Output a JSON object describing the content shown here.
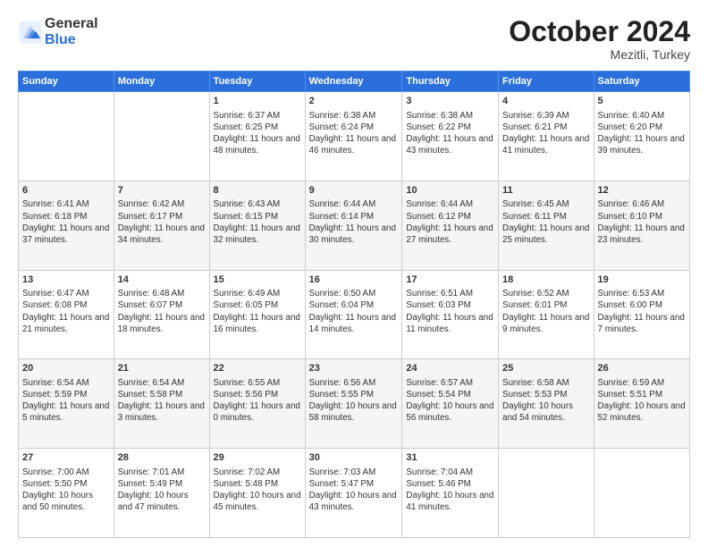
{
  "header": {
    "logo_general": "General",
    "logo_blue": "Blue",
    "month": "October 2024",
    "location": "Mezitli, Turkey"
  },
  "days_of_week": [
    "Sunday",
    "Monday",
    "Tuesday",
    "Wednesday",
    "Thursday",
    "Friday",
    "Saturday"
  ],
  "weeks": [
    [
      {
        "day": "",
        "info": ""
      },
      {
        "day": "",
        "info": ""
      },
      {
        "day": "1",
        "info": "Sunrise: 6:37 AM\nSunset: 6:25 PM\nDaylight: 11 hours and 48 minutes."
      },
      {
        "day": "2",
        "info": "Sunrise: 6:38 AM\nSunset: 6:24 PM\nDaylight: 11 hours and 46 minutes."
      },
      {
        "day": "3",
        "info": "Sunrise: 6:38 AM\nSunset: 6:22 PM\nDaylight: 11 hours and 43 minutes."
      },
      {
        "day": "4",
        "info": "Sunrise: 6:39 AM\nSunset: 6:21 PM\nDaylight: 11 hours and 41 minutes."
      },
      {
        "day": "5",
        "info": "Sunrise: 6:40 AM\nSunset: 6:20 PM\nDaylight: 11 hours and 39 minutes."
      }
    ],
    [
      {
        "day": "6",
        "info": "Sunrise: 6:41 AM\nSunset: 6:18 PM\nDaylight: 11 hours and 37 minutes."
      },
      {
        "day": "7",
        "info": "Sunrise: 6:42 AM\nSunset: 6:17 PM\nDaylight: 11 hours and 34 minutes."
      },
      {
        "day": "8",
        "info": "Sunrise: 6:43 AM\nSunset: 6:15 PM\nDaylight: 11 hours and 32 minutes."
      },
      {
        "day": "9",
        "info": "Sunrise: 6:44 AM\nSunset: 6:14 PM\nDaylight: 11 hours and 30 minutes."
      },
      {
        "day": "10",
        "info": "Sunrise: 6:44 AM\nSunset: 6:12 PM\nDaylight: 11 hours and 27 minutes."
      },
      {
        "day": "11",
        "info": "Sunrise: 6:45 AM\nSunset: 6:11 PM\nDaylight: 11 hours and 25 minutes."
      },
      {
        "day": "12",
        "info": "Sunrise: 6:46 AM\nSunset: 6:10 PM\nDaylight: 11 hours and 23 minutes."
      }
    ],
    [
      {
        "day": "13",
        "info": "Sunrise: 6:47 AM\nSunset: 6:08 PM\nDaylight: 11 hours and 21 minutes."
      },
      {
        "day": "14",
        "info": "Sunrise: 6:48 AM\nSunset: 6:07 PM\nDaylight: 11 hours and 18 minutes."
      },
      {
        "day": "15",
        "info": "Sunrise: 6:49 AM\nSunset: 6:05 PM\nDaylight: 11 hours and 16 minutes."
      },
      {
        "day": "16",
        "info": "Sunrise: 6:50 AM\nSunset: 6:04 PM\nDaylight: 11 hours and 14 minutes."
      },
      {
        "day": "17",
        "info": "Sunrise: 6:51 AM\nSunset: 6:03 PM\nDaylight: 11 hours and 11 minutes."
      },
      {
        "day": "18",
        "info": "Sunrise: 6:52 AM\nSunset: 6:01 PM\nDaylight: 11 hours and 9 minutes."
      },
      {
        "day": "19",
        "info": "Sunrise: 6:53 AM\nSunset: 6:00 PM\nDaylight: 11 hours and 7 minutes."
      }
    ],
    [
      {
        "day": "20",
        "info": "Sunrise: 6:54 AM\nSunset: 5:59 PM\nDaylight: 11 hours and 5 minutes."
      },
      {
        "day": "21",
        "info": "Sunrise: 6:54 AM\nSunset: 5:58 PM\nDaylight: 11 hours and 3 minutes."
      },
      {
        "day": "22",
        "info": "Sunrise: 6:55 AM\nSunset: 5:56 PM\nDaylight: 11 hours and 0 minutes."
      },
      {
        "day": "23",
        "info": "Sunrise: 6:56 AM\nSunset: 5:55 PM\nDaylight: 10 hours and 58 minutes."
      },
      {
        "day": "24",
        "info": "Sunrise: 6:57 AM\nSunset: 5:54 PM\nDaylight: 10 hours and 56 minutes."
      },
      {
        "day": "25",
        "info": "Sunrise: 6:58 AM\nSunset: 5:53 PM\nDaylight: 10 hours and 54 minutes."
      },
      {
        "day": "26",
        "info": "Sunrise: 6:59 AM\nSunset: 5:51 PM\nDaylight: 10 hours and 52 minutes."
      }
    ],
    [
      {
        "day": "27",
        "info": "Sunrise: 7:00 AM\nSunset: 5:50 PM\nDaylight: 10 hours and 50 minutes."
      },
      {
        "day": "28",
        "info": "Sunrise: 7:01 AM\nSunset: 5:49 PM\nDaylight: 10 hours and 47 minutes."
      },
      {
        "day": "29",
        "info": "Sunrise: 7:02 AM\nSunset: 5:48 PM\nDaylight: 10 hours and 45 minutes."
      },
      {
        "day": "30",
        "info": "Sunrise: 7:03 AM\nSunset: 5:47 PM\nDaylight: 10 hours and 43 minutes."
      },
      {
        "day": "31",
        "info": "Sunrise: 7:04 AM\nSunset: 5:46 PM\nDaylight: 10 hours and 41 minutes."
      },
      {
        "day": "",
        "info": ""
      },
      {
        "day": "",
        "info": ""
      }
    ]
  ]
}
